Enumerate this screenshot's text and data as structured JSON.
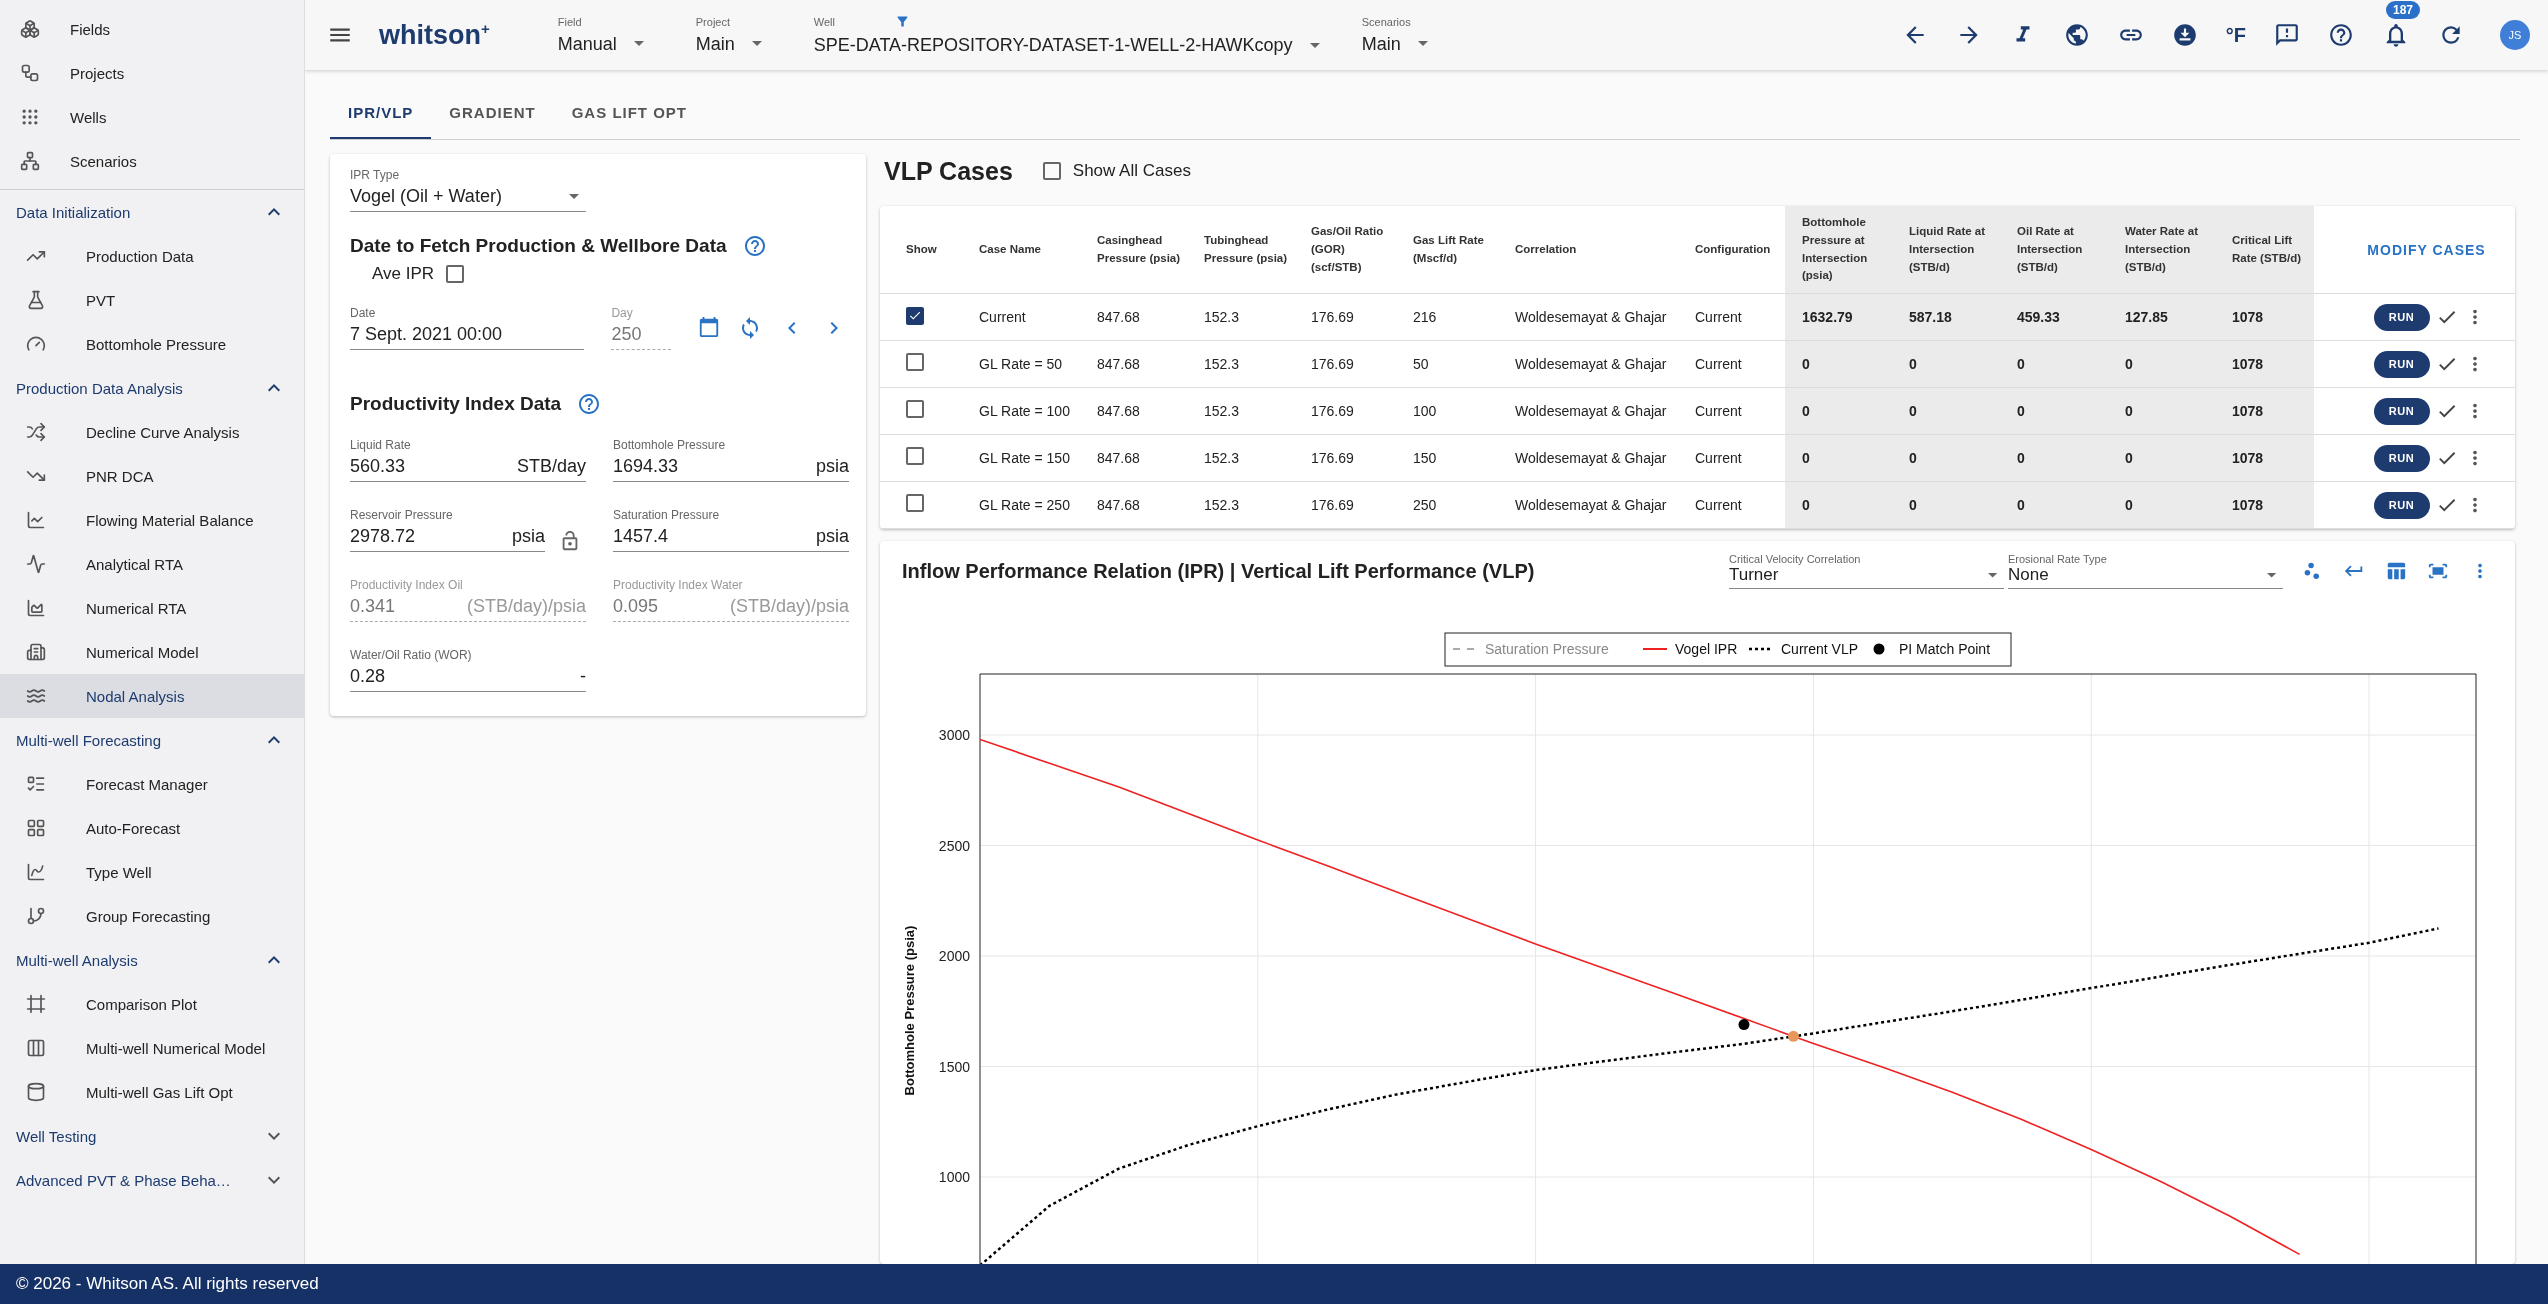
{
  "sidebar": {
    "top_items": [
      {
        "label": "Fields",
        "selected": false
      },
      {
        "label": "Projects",
        "selected": false
      },
      {
        "label": "Wells",
        "selected": false
      },
      {
        "label": "Scenarios",
        "selected": false
      }
    ],
    "sections": [
      {
        "title": "Data Initialization",
        "expanded": true,
        "items": [
          {
            "label": "Production Data",
            "selected": false
          },
          {
            "label": "PVT",
            "selected": false
          },
          {
            "label": "Bottomhole Pressure",
            "selected": false
          }
        ]
      },
      {
        "title": "Production Data Analysis",
        "expanded": true,
        "items": [
          {
            "label": "Decline Curve Analysis",
            "selected": false
          },
          {
            "label": "PNR DCA",
            "selected": false
          },
          {
            "label": "Flowing Material Balance",
            "selected": false
          },
          {
            "label": "Analytical RTA",
            "selected": false
          },
          {
            "label": "Numerical RTA",
            "selected": false
          },
          {
            "label": "Numerical Model",
            "selected": false
          },
          {
            "label": "Nodal Analysis",
            "selected": true
          }
        ]
      },
      {
        "title": "Multi-well Forecasting",
        "expanded": true,
        "items": [
          {
            "label": "Forecast Manager",
            "selected": false
          },
          {
            "label": "Auto-Forecast",
            "selected": false
          },
          {
            "label": "Type Well",
            "selected": false
          },
          {
            "label": "Group Forecasting",
            "selected": false
          }
        ]
      },
      {
        "title": "Multi-well Analysis",
        "expanded": true,
        "items": [
          {
            "label": "Comparison Plot",
            "selected": false
          },
          {
            "label": "Multi-well Numerical Model",
            "selected": false
          },
          {
            "label": "Multi-well Gas Lift Opt",
            "selected": false
          }
        ]
      },
      {
        "title": "Well Testing",
        "expanded": false
      },
      {
        "title": "Advanced PVT & Phase Beha…",
        "expanded": false
      }
    ]
  },
  "topbar": {
    "logo": "whitson$^{+}$",
    "selectors": [
      {
        "label": "Field",
        "value": "Manual",
        "filter": false
      },
      {
        "label": "Project",
        "value": "Main",
        "filter": false
      },
      {
        "label": "Well",
        "value": "SPE-DATA-REPOSITORY-DATASET-1-WELL-2-HAWKcopy",
        "filter": true
      },
      {
        "label": "Scenarios",
        "value": "Main",
        "filter": false
      }
    ],
    "unit_toggle": "°F",
    "notifications": "187",
    "avatar": "JS"
  },
  "tabs": [
    {
      "label": "IPR/VLP",
      "selected": true
    },
    {
      "label": "GRADIENT",
      "selected": false
    },
    {
      "label": "GAS LIFT OPT",
      "selected": false
    }
  ],
  "ipr_panel": {
    "ipr_type": {
      "label": "IPR Type",
      "value": "Vogel (Oil + Water)"
    },
    "date_title": "Date to Fetch Production & Wellbore Data",
    "ave_ipr": {
      "label": "Ave IPR",
      "checked": false
    },
    "date": {
      "label": "Date",
      "value": "7 Sept. 2021 00:00"
    },
    "day": {
      "label": "Day",
      "value": "250",
      "disabled": true
    },
    "pi_title": "Productivity Index Data",
    "fields": [
      {
        "kind": "plain",
        "label": "Liquid Rate",
        "value": "560.33",
        "unit": "STB/day",
        "disabled": false
      },
      {
        "kind": "plain",
        "label": "Bottomhole Pressure",
        "value": "1694.33",
        "unit": "psia",
        "disabled": false
      },
      {
        "kind": "lockable",
        "label": "Reservoir Pressure",
        "value": "2978.72",
        "unit": "psia",
        "disabled": false,
        "locked": false
      },
      {
        "kind": "plain",
        "label": "Saturation Pressure",
        "value": "1457.4",
        "unit": "psia",
        "disabled": false
      },
      {
        "kind": "plain",
        "label": "Productivity Index Oil",
        "value": "0.341",
        "unit": "(STB/day)/psia",
        "disabled": true
      },
      {
        "kind": "plain",
        "label": "Productivity Index Water",
        "value": "0.095",
        "unit": "(STB/day)/psia",
        "disabled": true
      },
      {
        "kind": "plain",
        "label": "Water/Oil Ratio (WOR)",
        "value": "0.28",
        "unit": "-",
        "disabled": false
      }
    ]
  },
  "vlp": {
    "title": "VLP Cases",
    "show_all": {
      "label": "Show All Cases",
      "checked": false
    },
    "show_header": "Show",
    "columns": [
      "Case Name",
      "Casinghead Pressure (psia)",
      "Tubinghead Pressure (psia)",
      "Gas/Oil Ratio (GOR) (scf/STB)",
      "Gas Lift Rate (Mscf/d)",
      "Correlation",
      "Configuration",
      "Bottomhole Pressure at Intersection (psia)",
      "Liquid Rate at Intersection (STB/d)",
      "Oil Rate at Intersection (STB/d)",
      "Water Rate at Intersection (STB/d)",
      "Critical Lift Rate (STB/d)",
      "MODIFY CASES"
    ],
    "rows": [
      {
        "show": true,
        "cells": [
          "Current",
          "847.68",
          "152.3",
          "176.69",
          "216",
          "Woldesemayat & Ghajar",
          "Current",
          "1632.79",
          "587.18",
          "459.33",
          "127.85",
          "1078",
          "RUN"
        ]
      },
      {
        "show": false,
        "cells": [
          "GL Rate = 50",
          "847.68",
          "152.3",
          "176.69",
          "50",
          "Woldesemayat & Ghajar",
          "Current",
          "0",
          "0",
          "0",
          "0",
          "1078",
          "RUN"
        ]
      },
      {
        "show": false,
        "cells": [
          "GL Rate = 100",
          "847.68",
          "152.3",
          "176.69",
          "100",
          "Woldesemayat & Ghajar",
          "Current",
          "0",
          "0",
          "0",
          "0",
          "1078",
          "RUN"
        ]
      },
      {
        "show": false,
        "cells": [
          "GL Rate = 150",
          "847.68",
          "152.3",
          "176.69",
          "150",
          "Woldesemayat & Ghajar",
          "Current",
          "0",
          "0",
          "0",
          "0",
          "1078",
          "RUN"
        ]
      },
      {
        "show": false,
        "cells": [
          "GL Rate = 250",
          "847.68",
          "152.3",
          "176.69",
          "250",
          "Woldesemayat & Ghajar",
          "Current",
          "0",
          "0",
          "0",
          "0",
          "1078",
          "RUN"
        ]
      }
    ]
  },
  "chart_card": {
    "title": "Inflow Performance Relation (IPR) | Vertical Lift Performance (VLP)",
    "dropdowns": [
      {
        "label": "Critical Velocity Correlation",
        "value": "Turner"
      },
      {
        "label": "Erosional Rate Type",
        "value": "None"
      }
    ],
    "extra_legend": [
      {
        "kind": "dashed",
        "label": "Saturation Pressure",
        "on": false
      }
    ],
    "chart_data": {
      "type": "line",
      "ylabel": "Bottomhole Pressure (psia)",
      "ylim": [
        593,
        3276
      ],
      "grid": true,
      "legend": "top",
      "yticks": [
        {
          "value": 1000,
          "label": "1000"
        },
        {
          "value": 1500,
          "label": "1500"
        },
        {
          "value": 2000,
          "label": "2000"
        },
        {
          "value": 2500,
          "label": "2500"
        },
        {
          "value": 3000,
          "label": "3000"
        }
      ],
      "categories": [
        null,
        null,
        null,
        null,
        null,
        null,
        null,
        null,
        null,
        null,
        null,
        null,
        null,
        null,
        null,
        null,
        null,
        null,
        null,
        null,
        null,
        null
      ],
      "series": [
        {
          "name": "Vogel IPR",
          "color": "#ee2222",
          "line_style": "solid",
          "values": [
            2980,
            2872,
            2765,
            2645,
            2525,
            2408,
            2290,
            2172,
            2055,
            1942,
            1830,
            1717,
            1604,
            1497,
            1384,
            1260,
            1125,
            980,
            823,
            650,
            null,
            null
          ]
        },
        {
          "name": "Current VLP",
          "color": "#000000",
          "line_style": "dotted",
          "values": [
            600,
            870,
            1038,
            1145,
            1230,
            1305,
            1374,
            1430,
            1484,
            1525,
            1565,
            1603,
            1650,
            1700,
            1750,
            1802,
            1855,
            1907,
            1960,
            2010,
            2060,
            2125
          ]
        },
        {
          "name": "PI Match Point",
          "color": "#000000",
          "marker": "circle",
          "values": [
            null,
            null,
            null,
            null,
            null,
            null,
            null,
            null,
            null,
            null,
            null,
            1690,
            null,
            null,
            null,
            null,
            null,
            null,
            null,
            null,
            null,
            null
          ]
        }
      ]
    }
  },
  "footer": "© 2026 - Whitson AS. All rights reserved"
}
